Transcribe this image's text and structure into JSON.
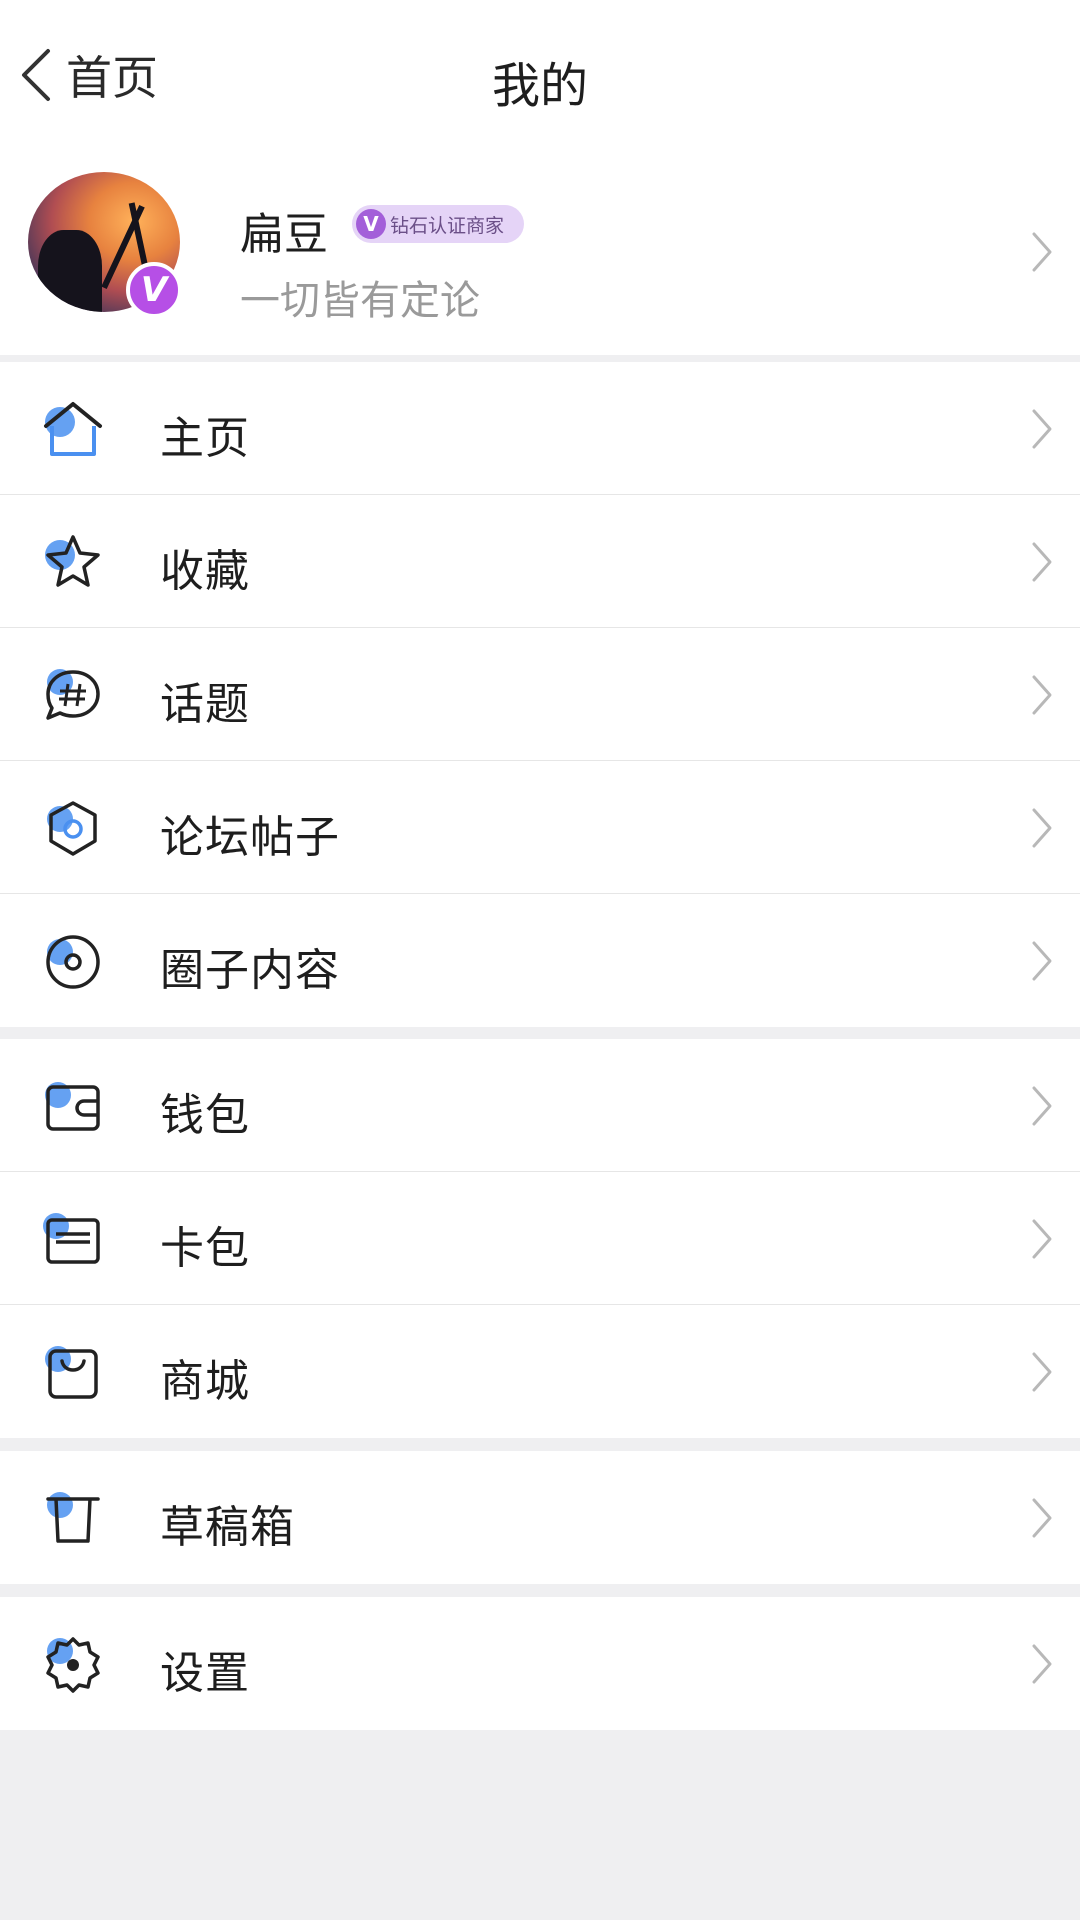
{
  "nav": {
    "back_label": "首页",
    "title": "我的"
  },
  "profile": {
    "name": "扁豆",
    "badge_letter": "V",
    "cert_letter": "V",
    "cert_label": "钻石认证商家",
    "signature": "一切皆有定论"
  },
  "groups": [
    [
      {
        "label": "主页",
        "icon": "home-icon"
      },
      {
        "label": "收藏",
        "icon": "star-icon"
      },
      {
        "label": "话题",
        "icon": "hashtag-bubble-icon"
      },
      {
        "label": "论坛帖子",
        "icon": "hexagon-icon"
      },
      {
        "label": "圈子内容",
        "icon": "circle-target-icon"
      }
    ],
    [
      {
        "label": "钱包",
        "icon": "wallet-icon"
      },
      {
        "label": "卡包",
        "icon": "card-icon"
      },
      {
        "label": "商城",
        "icon": "shopping-bag-icon"
      }
    ],
    [
      {
        "label": "草稿箱",
        "icon": "trash-bin-icon"
      }
    ],
    [
      {
        "label": "设置",
        "icon": "gear-icon"
      }
    ]
  ],
  "colors": {
    "accent_blue": "#4a90f0",
    "badge_purple": "#b64fe6",
    "background": "#efeff1"
  }
}
